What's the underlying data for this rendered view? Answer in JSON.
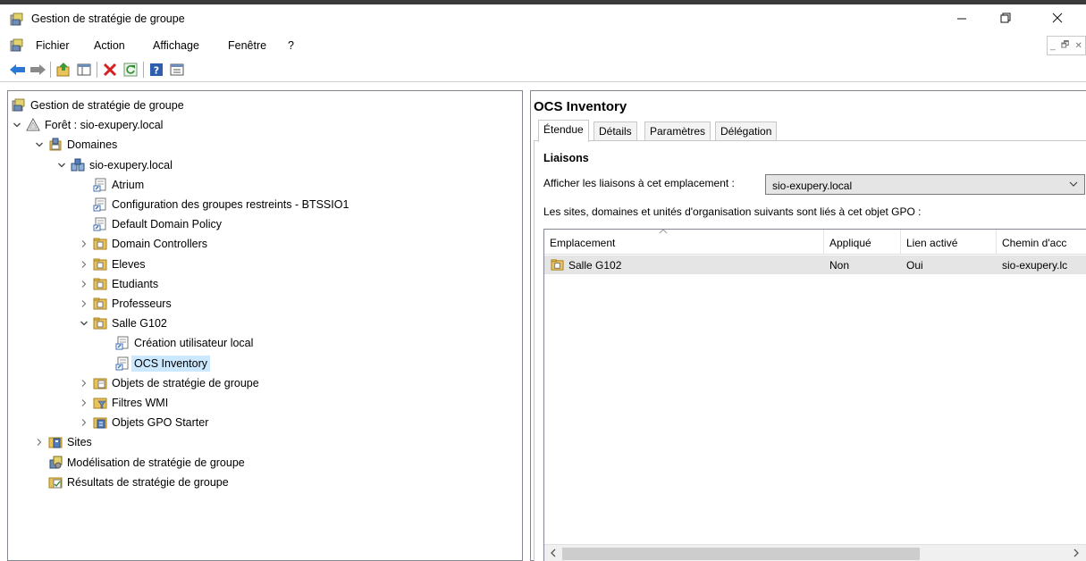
{
  "window": {
    "title": "Gestion de stratégie de groupe",
    "icon": "gpmc-icon",
    "controls": {
      "minimize": "–",
      "maximize": "❐",
      "close": "✕"
    }
  },
  "menu": {
    "items": [
      "Fichier",
      "Action",
      "Affichage",
      "Fenêtre",
      "?"
    ],
    "mdi_controls": {
      "minimize": "_",
      "restore": "🗗",
      "close": "✕"
    }
  },
  "toolbar": {
    "buttons": [
      "back-arrow-icon",
      "forward-arrow-icon",
      "up-folder-icon",
      "show-hide-console-tree-icon",
      "delete-icon",
      "refresh-icon",
      "help-icon",
      "properties-icon"
    ]
  },
  "tree": {
    "nodes": [
      {
        "label": "Gestion de stratégie de groupe",
        "icon": "gpmc-icon",
        "expander": "",
        "level": 0
      },
      {
        "label": "Forêt : sio-exupery.local",
        "icon": "forest-icon",
        "expander": "open",
        "level": 0
      },
      {
        "label": "Domaines",
        "icon": "domains-icon",
        "expander": "open",
        "level": 1
      },
      {
        "label": "sio-exupery.local",
        "icon": "domain-icon",
        "expander": "open",
        "level": 2
      },
      {
        "label": "Atrium",
        "icon": "gpo-link-icon",
        "expander": "",
        "level": 3
      },
      {
        "label": "Configuration des groupes restreints - BTSSIO1",
        "icon": "gpo-link-icon",
        "expander": "",
        "level": 3
      },
      {
        "label": "Default Domain Policy",
        "icon": "gpo-link-icon",
        "expander": "",
        "level": 3
      },
      {
        "label": "Domain Controllers",
        "icon": "ou-icon",
        "expander": "closed",
        "level": 3
      },
      {
        "label": "Eleves",
        "icon": "ou-icon",
        "expander": "closed",
        "level": 3
      },
      {
        "label": "Etudiants",
        "icon": "ou-icon",
        "expander": "closed",
        "level": 3
      },
      {
        "label": "Professeurs",
        "icon": "ou-icon",
        "expander": "closed",
        "level": 3
      },
      {
        "label": "Salle G102",
        "icon": "ou-icon",
        "expander": "open",
        "level": 3
      },
      {
        "label": "Création utilisateur local",
        "icon": "gpo-link-icon",
        "expander": "",
        "level": 4
      },
      {
        "label": "OCS Inventory",
        "icon": "gpo-link-icon",
        "expander": "",
        "level": 4,
        "selected": true
      },
      {
        "label": "Objets de stratégie de groupe",
        "icon": "gpo-container-icon",
        "expander": "closed",
        "level": 3
      },
      {
        "label": "Filtres WMI",
        "icon": "wmi-filter-icon",
        "expander": "closed",
        "level": 3
      },
      {
        "label": "Objets GPO Starter",
        "icon": "starter-gpo-icon",
        "expander": "closed",
        "level": 3
      },
      {
        "label": "Sites",
        "icon": "sites-icon",
        "expander": "closed",
        "level": 1
      },
      {
        "label": "Modélisation de stratégie de groupe",
        "icon": "modeling-icon",
        "expander": "",
        "level": 1
      },
      {
        "label": "Résultats de stratégie de groupe",
        "icon": "results-icon",
        "expander": "",
        "level": 1
      }
    ]
  },
  "details": {
    "title": "OCS Inventory",
    "tabs": [
      "Étendue",
      "Détails",
      "Paramètres",
      "Délégation"
    ],
    "active_tab": "Étendue",
    "section_title": "Liaisons",
    "links_label": "Afficher les liaisons à cet emplacement :",
    "links_location": "sio-exupery.local",
    "description": "Les sites, domaines et unités d'organisation suivants sont liés à cet objet GPO :",
    "columns": [
      "Emplacement",
      "Appliqué",
      "Lien activé",
      "Chemin d'acc"
    ],
    "rows": [
      {
        "location": "Salle G102",
        "enforced": "Non",
        "enabled": "Oui",
        "path": "sio-exupery.lc"
      }
    ]
  }
}
